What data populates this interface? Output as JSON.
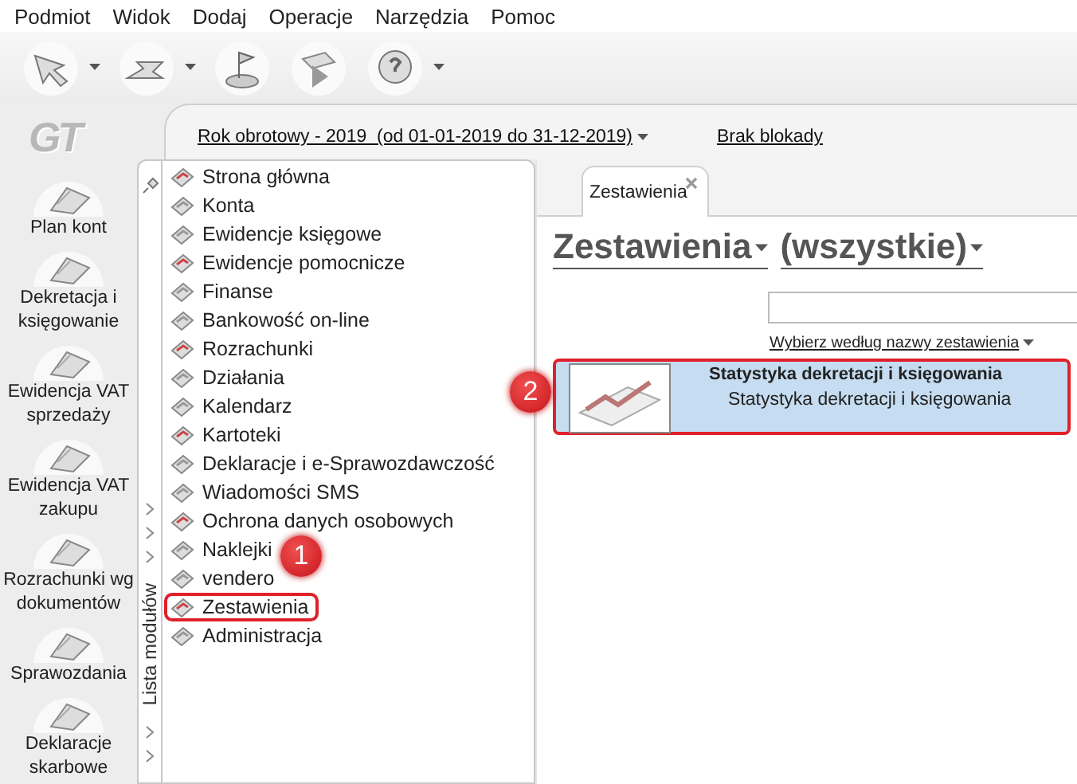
{
  "menu": [
    "Podmiot",
    "Widok",
    "Dodaj",
    "Operacje",
    "Narzędzia",
    "Pomoc"
  ],
  "toolbar": [
    {
      "kind": "dropdown"
    },
    {
      "kind": "dropdown"
    },
    {
      "kind": "plain"
    },
    {
      "kind": "plain"
    },
    {
      "kind": "dropdown"
    }
  ],
  "logo": "GT",
  "sidebar": {
    "items": [
      {
        "label": "Plan kont"
      },
      {
        "label": "Dekretacja i księgowanie"
      },
      {
        "label": "Ewidencja VAT sprzedaży"
      },
      {
        "label": "Ewidencja VAT zakupu"
      },
      {
        "label": "Rozrachunki wg dokumentów"
      },
      {
        "label": "Sprawozdania"
      },
      {
        "label": "Deklaracje skarbowe"
      }
    ]
  },
  "topbar": {
    "fiscal_year": "Rok obrotowy - 2019  (od 01-01-2019 do 31-12-2019)",
    "lock_status": "Brak blokady"
  },
  "modules": {
    "label": "Lista modułów",
    "items": [
      {
        "label": "Strona główna",
        "highlighted": false
      },
      {
        "label": "Konta",
        "highlighted": false
      },
      {
        "label": "Ewidencje księgowe",
        "highlighted": false
      },
      {
        "label": "Ewidencje pomocnicze",
        "highlighted": false
      },
      {
        "label": "Finanse",
        "highlighted": false
      },
      {
        "label": "Bankowość on-line",
        "highlighted": false
      },
      {
        "label": "Rozrachunki",
        "highlighted": false
      },
      {
        "label": "Działania",
        "highlighted": false
      },
      {
        "label": "Kalendarz",
        "highlighted": false
      },
      {
        "label": "Kartoteki",
        "highlighted": false
      },
      {
        "label": "Deklaracje i e-Sprawozdawczość",
        "highlighted": false
      },
      {
        "label": "Wiadomości SMS",
        "highlighted": false
      },
      {
        "label": "Ochrona danych osobowych",
        "highlighted": false
      },
      {
        "label": "Naklejki",
        "highlighted": false
      },
      {
        "label": "vendero",
        "highlighted": false
      },
      {
        "label": "Zestawienia",
        "highlighted": true
      },
      {
        "label": "Administracja",
        "highlighted": false
      }
    ]
  },
  "content": {
    "tab": {
      "label": "Zestawienia"
    },
    "heading": "Zestawienia",
    "filter": "(wszystkie)",
    "sort_link": "Wybierz według nazwy zestawienia",
    "items": [
      {
        "title": "Statystyka dekretacji i księgowania",
        "description": "Statystyka dekretacji i księgowania",
        "selected": true,
        "highlighted": true
      }
    ]
  },
  "annotations": [
    {
      "label": "1"
    },
    {
      "label": "2"
    }
  ]
}
